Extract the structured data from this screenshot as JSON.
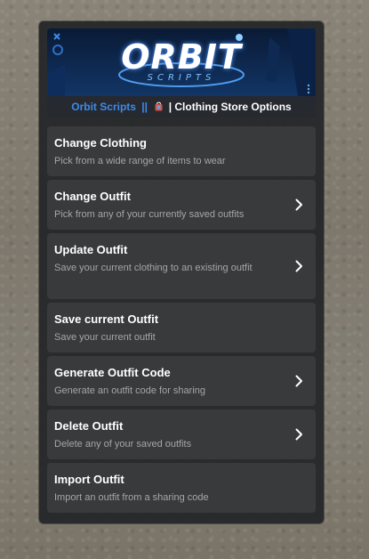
{
  "header": {
    "logo_text": "ORBIT",
    "logo_subtext": "SCRIPTS",
    "brand": "Orbit Scripts",
    "separator": "||",
    "bag_icon": "shopping-bag-icon",
    "store_label": "| Clothing Store Options"
  },
  "menu": {
    "items": [
      {
        "title": "Change Clothing",
        "description": "Pick from a wide range of items to wear",
        "has_submenu": false
      },
      {
        "title": "Change Outfit",
        "description": "Pick from any of your currently saved outfits",
        "has_submenu": true
      },
      {
        "title": "Update Outfit",
        "description": "Save your current clothing to an existing outfit",
        "has_submenu": true
      },
      {
        "title": "Save current Outfit",
        "description": "Save your current outfit",
        "has_submenu": false
      },
      {
        "title": "Generate Outfit Code",
        "description": "Generate an outfit code for sharing",
        "has_submenu": true
      },
      {
        "title": "Delete Outfit",
        "description": "Delete any of your saved outfits",
        "has_submenu": true
      },
      {
        "title": "Import Outfit",
        "description": "Import an outfit from a sharing code",
        "has_submenu": false
      }
    ]
  },
  "colors": {
    "brand_blue": "#3d8bea",
    "panel_bg": "#222426",
    "item_bg": "#3a3c3e",
    "title_text": "#ffffff",
    "desc_text": "#a5a6a8"
  }
}
